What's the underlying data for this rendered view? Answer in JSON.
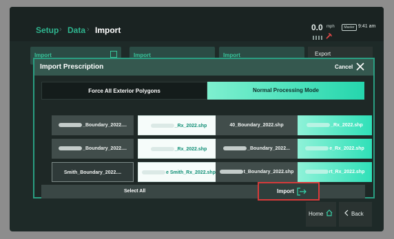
{
  "breadcrumb": {
    "setup": "Setup",
    "data": "Data",
    "import": "Import",
    "separator": "›"
  },
  "status": {
    "speed": "0.0",
    "speed_unit": "mph",
    "master_badge": "Master",
    "time": "9:41 am"
  },
  "background_cards": [
    "Import",
    "Import",
    "Import"
  ],
  "right_panel": {
    "export_label": "Export",
    "home_label": "Home",
    "back_label": "Back"
  },
  "modal": {
    "title": "Import Prescription",
    "cancel_label": "Cancel",
    "tabs": {
      "force_polygons": "Force All Exterior Polygons",
      "normal_mode": "Normal Processing Mode"
    },
    "files": [
      {
        "name": "_Boundary_2022...."
      },
      {
        "name": "_Rx_2022.shp"
      },
      {
        "name": "40_Boundary_2022.shp"
      },
      {
        "name": "_Rx_2022.shp"
      },
      {
        "name": "_Boundary_2022...."
      },
      {
        "name": "_Rx_2022.shp"
      },
      {
        "name": "_Boundary_2022..."
      },
      {
        "name": "e_Rx_2022.shp"
      },
      {
        "name": "Smith_Boundary_2022...."
      },
      {
        "name": "e Smith_Rx_2022.shp"
      },
      {
        "name": "t_Boundary_2022.shp"
      },
      {
        "name": "rt_Rx_2022.shp"
      }
    ],
    "select_all_label": "Select All",
    "import_label": "Import"
  },
  "colors": {
    "accent": "#2fb58f",
    "highlight": "#d93a3a",
    "mode_active": "#25d6ad"
  }
}
